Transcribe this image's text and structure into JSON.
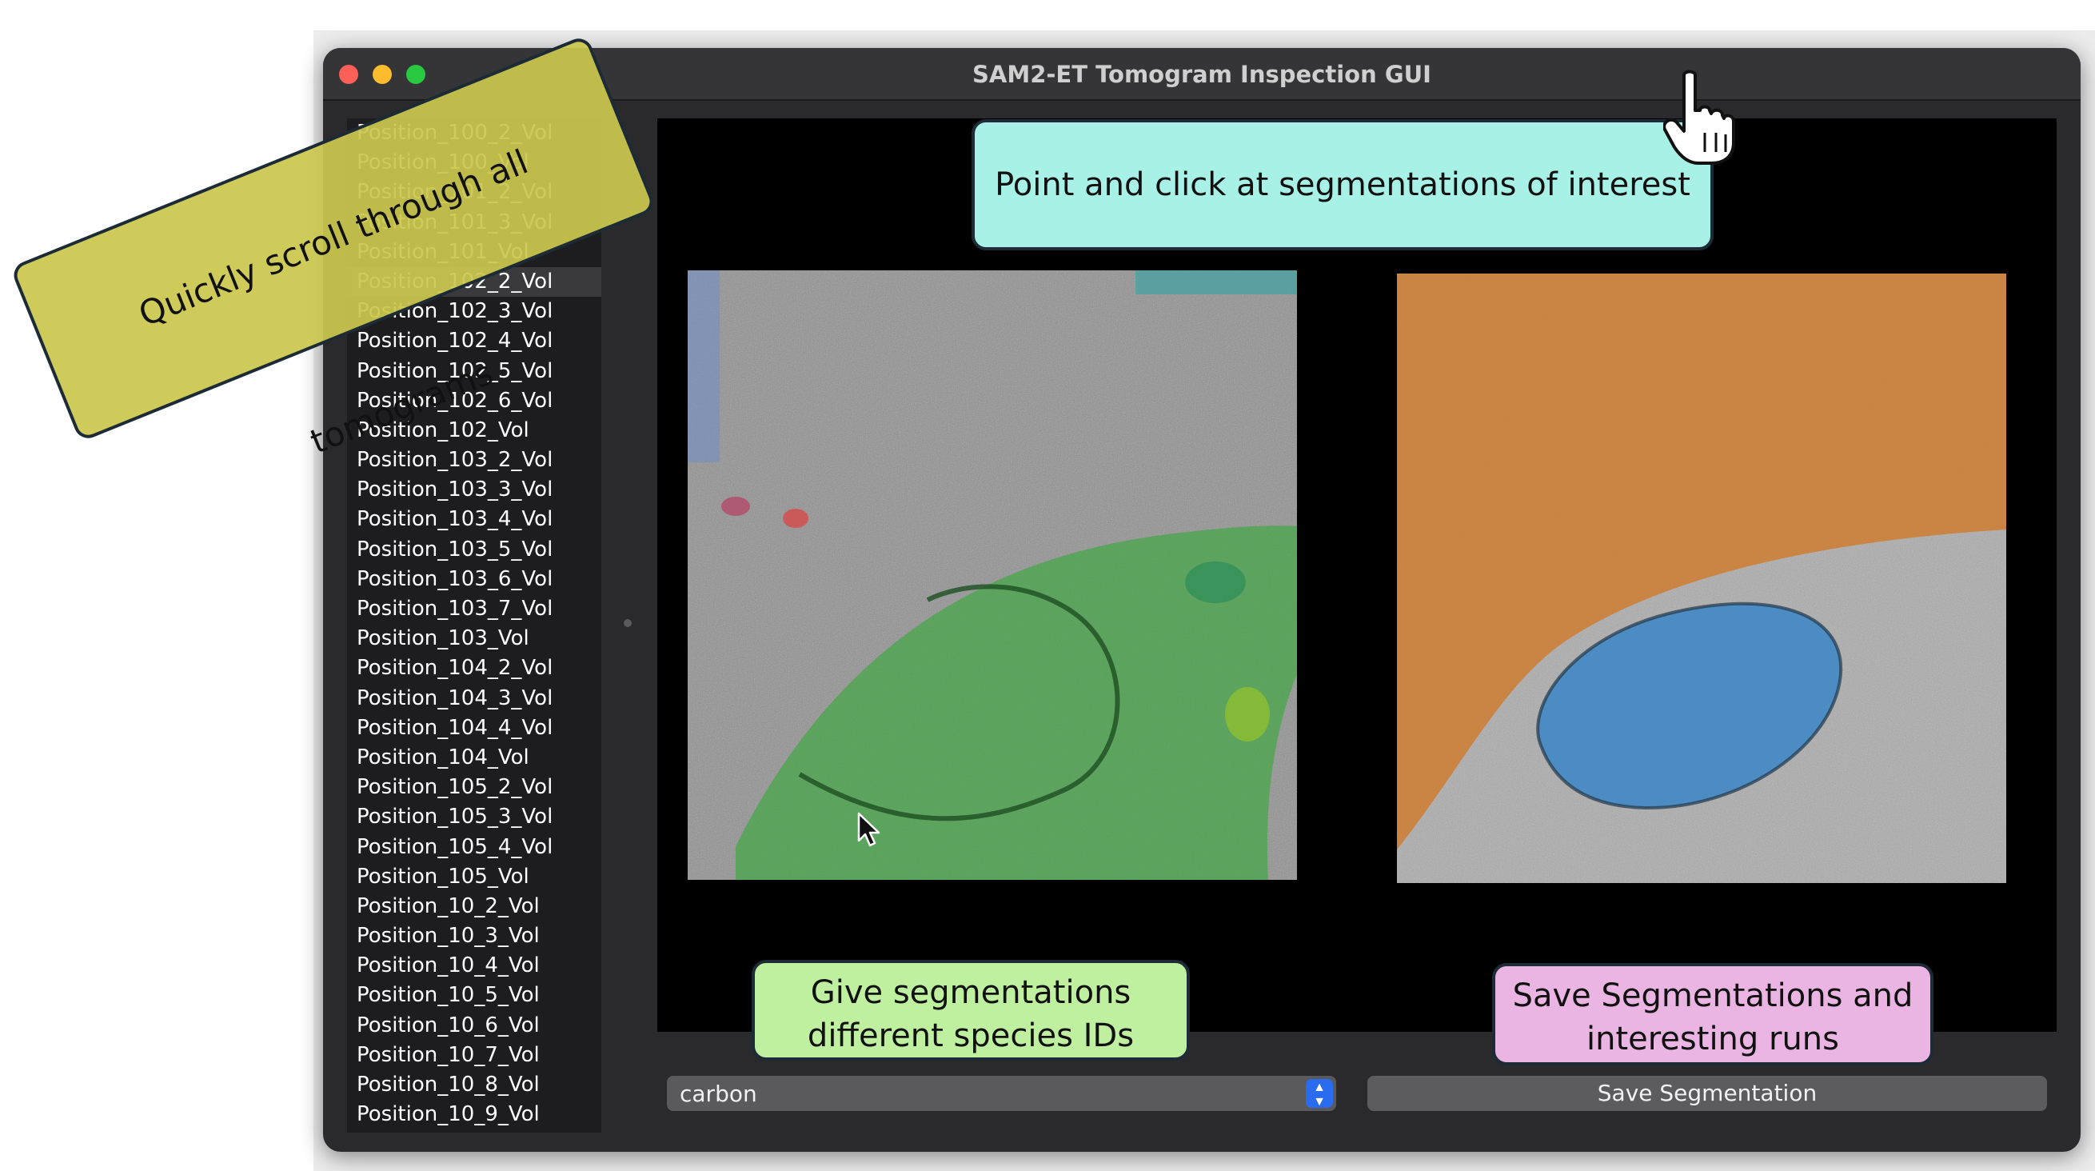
{
  "window": {
    "title": "SAM2-ET Tomogram Inspection GUI"
  },
  "sidebar": {
    "selected_index": 5,
    "runs": [
      "Position_100_2_Vol",
      "Position_100_Vol",
      "Position_101_2_Vol",
      "Position_101_3_Vol",
      "Position_101_Vol",
      "Position_102_2_Vol",
      "Position_102_3_Vol",
      "Position_102_4_Vol",
      "Position_102_5_Vol",
      "Position_102_6_Vol",
      "Position_102_Vol",
      "Position_103_2_Vol",
      "Position_103_3_Vol",
      "Position_103_4_Vol",
      "Position_103_5_Vol",
      "Position_103_6_Vol",
      "Position_103_7_Vol",
      "Position_103_Vol",
      "Position_104_2_Vol",
      "Position_104_3_Vol",
      "Position_104_4_Vol",
      "Position_104_Vol",
      "Position_105_2_Vol",
      "Position_105_3_Vol",
      "Position_105_4_Vol",
      "Position_105_Vol",
      "Position_10_2_Vol",
      "Position_10_3_Vol",
      "Position_10_4_Vol",
      "Position_10_5_Vol",
      "Position_10_6_Vol",
      "Position_10_7_Vol",
      "Position_10_8_Vol",
      "Position_10_9_Vol"
    ]
  },
  "controls": {
    "species_value": "carbon",
    "save_label": "Save Segmentation"
  },
  "callouts": {
    "scroll": "Quickly scroll through all tomograms",
    "click": "Point and click at segmentations of interest",
    "species_line1": "Give segmentations",
    "species_line2": "different species IDs",
    "save_line1": "Save Segmentations and",
    "save_line2": "interesting runs"
  },
  "colors": {
    "overlay_green": "#4caf50",
    "overlay_orange": "#d9883f",
    "overlay_blue": "#3c87c2",
    "accent_blue": "#2a6cf0"
  },
  "icons": [
    "hand-pointer-icon",
    "arrow-cursor-icon",
    "chevron-up-down-icon"
  ]
}
